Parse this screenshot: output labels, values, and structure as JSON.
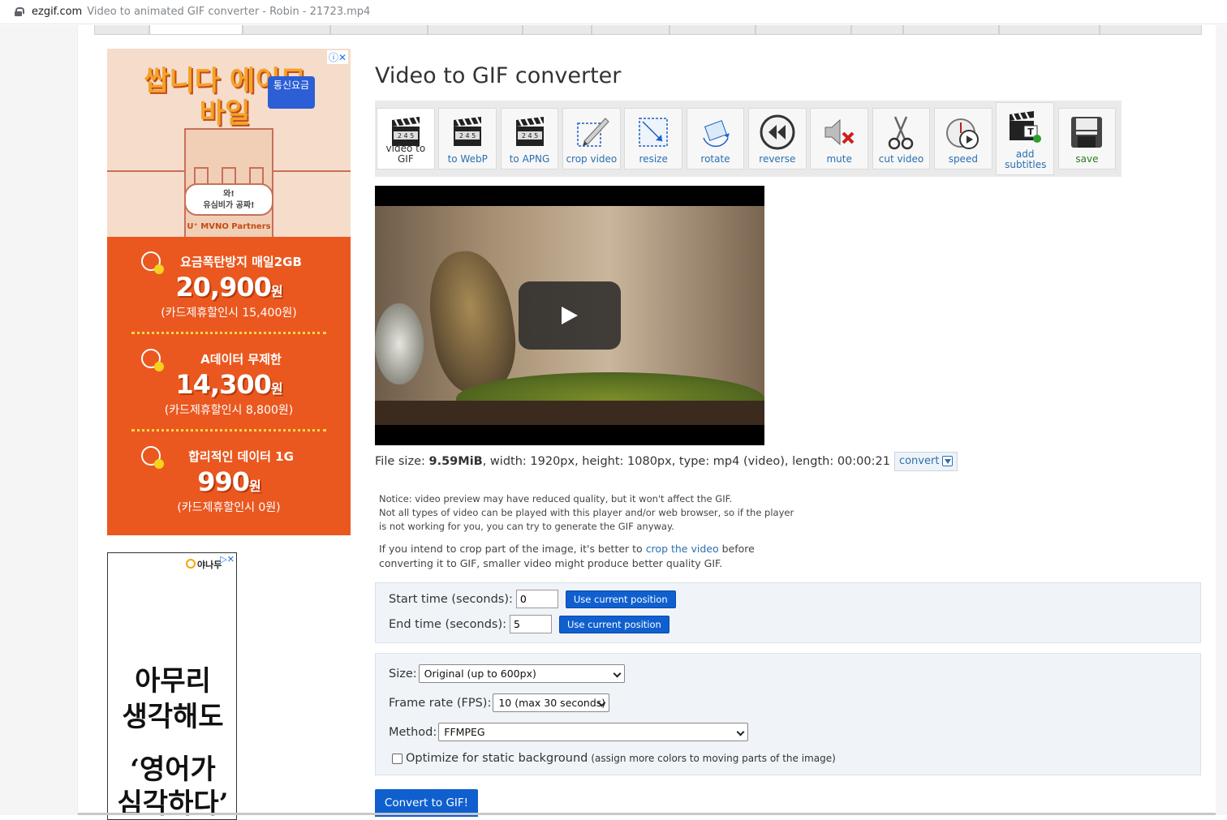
{
  "browser": {
    "domain": "ezgif.com",
    "tab_title": "Video to animated GIF converter - Robin - 21723.mp4"
  },
  "ads": {
    "ad1": {
      "brand": "쌉니다 에이모바일",
      "tag": "통신요금",
      "badge_line1": "와!",
      "badge_line2": "유심비가 공짜!",
      "partner": "U⁺ MVNO Partners",
      "close": "ⓘ✕",
      "sections": [
        {
          "title": "요금폭탄방지 매일2GB",
          "price": "20,900",
          "unit": "원",
          "sub": "(카드제휴할인시 15,400원)"
        },
        {
          "title": "A데이터 무제한",
          "price": "14,300",
          "unit": "원",
          "sub": "(카드제휴할인시 8,800원)"
        },
        {
          "title": "합리적인 데이터 1G",
          "price": "990",
          "unit": "원",
          "sub": "(카드제휴할인시 0원)"
        }
      ]
    },
    "ad2": {
      "logo": "야나두",
      "close": "▷✕",
      "line1": "아무리",
      "line2": "생각해도",
      "line3": "‘영어가",
      "line4": "심각하다’"
    }
  },
  "page": {
    "title": "Video to GIF converter"
  },
  "toolbar": {
    "tools": [
      {
        "label": "video to GIF",
        "icon": "clapper-icon"
      },
      {
        "label": "to WebP",
        "icon": "clapper-icon"
      },
      {
        "label": "to APNG",
        "icon": "clapper-icon"
      },
      {
        "label": "crop video",
        "icon": "crop-icon"
      },
      {
        "label": "resize",
        "icon": "resize-icon"
      },
      {
        "label": "rotate",
        "icon": "rotate-icon"
      },
      {
        "label": "reverse",
        "icon": "rewind-icon"
      },
      {
        "label": "mute",
        "icon": "mute-icon"
      },
      {
        "label": "cut video",
        "icon": "scissors-icon"
      },
      {
        "label": "speed",
        "icon": "stopwatch-icon"
      },
      {
        "label": "add subtitles",
        "icon": "subtitles-icon"
      },
      {
        "label": "save",
        "icon": "save-icon"
      }
    ]
  },
  "fileinfo": {
    "prefix": "File size: ",
    "size": "9.59MiB",
    "rest": ", width: 1920px, height: 1080px, type: mp4 (video), length: 00:00:21",
    "convert_label": "convert"
  },
  "notice": {
    "line1": "Notice: video preview may have reduced quality, but it won't affect the GIF.",
    "line2": "Not all types of video can be played with this player and/or web browser, so if the player",
    "line3": "is not working for you, you can try to generate the GIF anyway."
  },
  "hint": {
    "before": "If you intend to crop part of the image, it's better to ",
    "link": "crop the video",
    "after": " before converting it to GIF, smaller video might produce better quality GIF."
  },
  "time": {
    "start_label": "Start time (seconds):",
    "start_value": "0",
    "end_label": "End time (seconds):",
    "end_value": "5",
    "use_current": "Use current position"
  },
  "options": {
    "size_label": "Size:",
    "size_value": "Original (up to 600px)",
    "fps_label": "Frame rate (FPS):",
    "fps_value": "10 (max 30 seconds)",
    "method_label": "Method:",
    "method_value": "FFMPEG",
    "optimize_label": "Optimize for static background",
    "optimize_note": "(assign more colors to moving parts of the image)",
    "optimize_checked": false
  },
  "convert_gif_label": "Convert to GIF!"
}
